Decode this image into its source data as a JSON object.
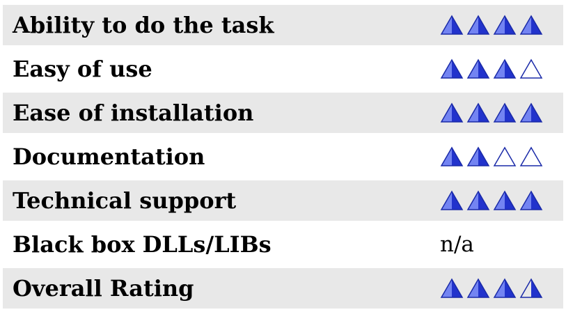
{
  "rows": [
    {
      "label": "Ability to do the task",
      "rating": 4,
      "max": 4,
      "shaded": true
    },
    {
      "label": "Easy of use",
      "rating": 3,
      "max": 4,
      "shaded": false
    },
    {
      "label": "Ease of installation",
      "rating": 4,
      "max": 4,
      "shaded": true
    },
    {
      "label": "Documentation",
      "rating": 2,
      "max": 4,
      "shaded": false
    },
    {
      "label": "Technical support",
      "rating": 4,
      "max": 4,
      "shaded": true
    },
    {
      "label": "Black box DLLs/LIBs",
      "text": "n/a",
      "shaded": false
    },
    {
      "label": "Overall Rating",
      "rating": 3.5,
      "max": 4,
      "shaded": true
    }
  ],
  "colors": {
    "icon_fill": "#2233cc",
    "icon_highlight": "#8fa0ff",
    "icon_outline": "#1a2aa8",
    "row_shade": "#e8e8e8"
  },
  "icon": "triangle-rating-icon"
}
